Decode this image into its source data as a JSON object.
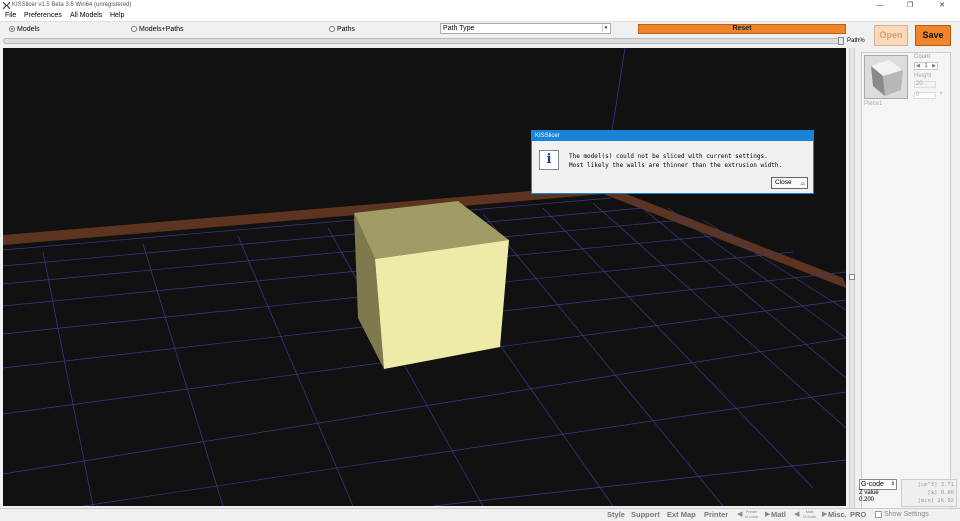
{
  "window": {
    "title": "KISSlicer v1.5 Beta 3.6 Win64 (unregistered)",
    "minimize": "—",
    "restore": "❐",
    "close": "✕"
  },
  "menu": {
    "items": [
      "File",
      "Preferences",
      "All Models",
      "Help"
    ]
  },
  "toolbar": {
    "view_modes": [
      {
        "label": "Models",
        "selected": true
      },
      {
        "label": "Models+Paths",
        "selected": false
      },
      {
        "label": "Paths",
        "selected": false
      }
    ],
    "path_type": "Path Type",
    "reset_label": "Reset",
    "path_pct_label": "Path%",
    "open_label": "Open",
    "save_label": "Save"
  },
  "dialog": {
    "title": "KISSlicer",
    "icon": "i",
    "line1": "The model(s) could not be sliced with current settings.",
    "line2": "Most likely the walls are thinner than the extrusion width.",
    "close_label": "Close"
  },
  "panel": {
    "piece_name": "Piece1",
    "count_label": "Count",
    "count_value": "1",
    "height_label": "Height",
    "height_value": "20",
    "rotation_value": "0",
    "rotation_unit": "°"
  },
  "output": {
    "format": "G-code",
    "z_label": "Z value",
    "z_value": "0.200",
    "volume": "[cm^3] 3.71",
    "cost": "[$] 0.00",
    "time": "[min] 26.92"
  },
  "bottom_tabs": {
    "style": "Style",
    "support": "Support",
    "extmap": "Ext Map",
    "printer": "Printer",
    "printer_gcode_top": "Printer",
    "printer_gcode_bottom": "G-code",
    "matl": "Matl",
    "matl_gcode_top": "Matl",
    "matl_gcode_bottom": "G-code",
    "misc": "Misc.",
    "pro": "PRO",
    "show_settings": "Show Settings"
  },
  "colors": {
    "accent_orange": "#f0842a",
    "dialog_blue": "#1883d7",
    "viewport_bg": "#111111",
    "bed_edge": "#5c3420",
    "cube_front": "#eeeaa8",
    "cube_top": "#a09c66",
    "cube_side": "#7e7a4e"
  }
}
